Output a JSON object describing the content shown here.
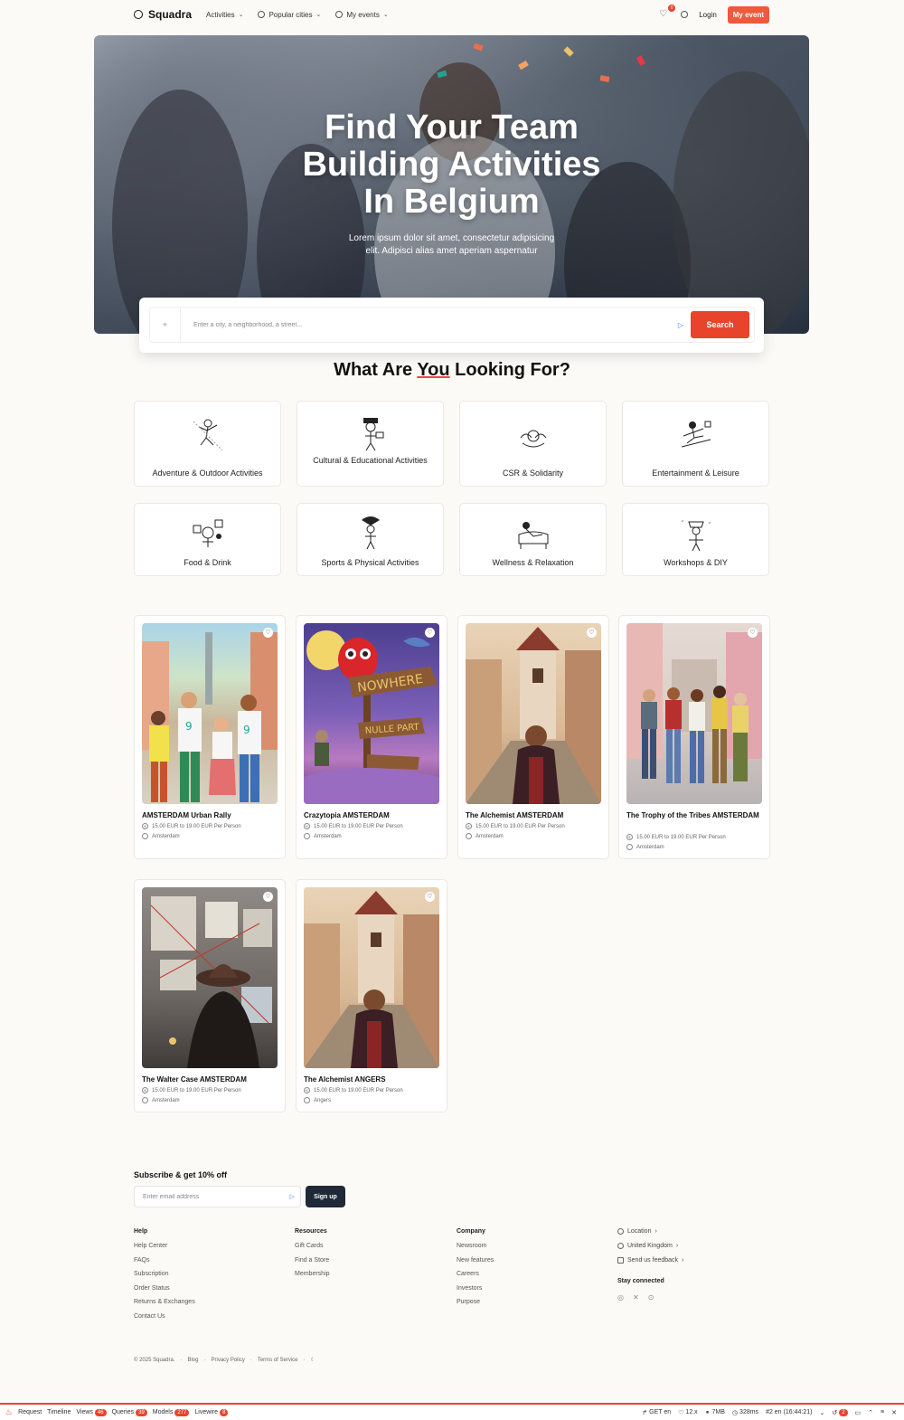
{
  "nav": {
    "brand": "Squadra",
    "menu": [
      {
        "label": "Activities"
      },
      {
        "label": "Popular cities"
      },
      {
        "label": "My events"
      }
    ],
    "favorites_count": "0",
    "login": "Login",
    "cta": "My event"
  },
  "hero": {
    "title_line1": "Find Your Team",
    "title_line2": "Building Activities",
    "title_line3": "In Belgium",
    "subtitle_line1": "Lorem ipsum dolor sit amet, consectetur adipisicing",
    "subtitle_line2": "elit. Adipisci alias amet aperiam aspernatur"
  },
  "search": {
    "placeholder": "Enter a city, a neighborhood, a street...",
    "button": "Search"
  },
  "categories_title": {
    "before": "What Are ",
    "highlight": "You",
    "after": " Looking For?"
  },
  "categories": [
    {
      "label": "Adventure & Outdoor Activities"
    },
    {
      "label": "Cultural & Educational Activities"
    },
    {
      "label": "CSR & Solidarity"
    },
    {
      "label": "Entertainment & Leisure"
    },
    {
      "label": "Food & Drink"
    },
    {
      "label": "Sports & Physical Activities"
    },
    {
      "label": "Wellness & Relaxation"
    },
    {
      "label": "Workshops & DIY"
    }
  ],
  "products": [
    {
      "title": "AMSTERDAM Urban Rally",
      "price": "15.00 EUR to 19.00 EUR Per Person",
      "city": "Amsterdam"
    },
    {
      "title": "Crazytopia AMSTERDAM",
      "price": "15.00 EUR to 19.00 EUR Per Person",
      "city": "Amsterdam"
    },
    {
      "title": "The Alchemist AMSTERDAM",
      "price": "15.00 EUR to 19.00 EUR Per Person",
      "city": "Amsterdam"
    },
    {
      "title": "The Trophy of the Tribes AMSTERDAM",
      "price": "15.00 EUR to 19.00 EUR Per Person",
      "city": "Amsterdam"
    },
    {
      "title": "The Walter Case AMSTERDAM",
      "price": "15.00 EUR to 19.00 EUR Per Person",
      "city": "Amsterdam"
    },
    {
      "title": "The Alchemist ANGERS",
      "price": "15.00 EUR to 19.00 EUR Per Person",
      "city": "Angers"
    }
  ],
  "footer": {
    "subscribe_title": "Subscribe & get 10% off",
    "email_placeholder": "Enter email address",
    "signup": "Sign up",
    "help": {
      "title": "Help",
      "links": [
        "Help Center",
        "FAQs",
        "Subscription",
        "Order Status",
        "Returns & Exchanges",
        "Contact Us"
      ]
    },
    "resources": {
      "title": "Resources",
      "links": [
        "Gift Cards",
        "Find a Store",
        "Membership"
      ]
    },
    "company": {
      "title": "Company",
      "links": [
        "Newsroom",
        "New features",
        "Careers",
        "Investors",
        "Purpose"
      ]
    },
    "settings": {
      "location": "Location",
      "country": "United Kingdom",
      "feedback": "Send us feedback"
    },
    "stay_connected": "Stay connected",
    "copyright": "© 2025 Squadra.",
    "blog": "Blog",
    "privacy": "Privacy Policy",
    "terms": "Terms of Service"
  },
  "debugbar": {
    "request": "Request",
    "timeline": "Timeline",
    "views": "Views",
    "views_count": "46",
    "queries": "Queries",
    "queries_count": "39",
    "models": "Models",
    "models_count": "277",
    "livewire": "Livewire",
    "livewire_count": "8",
    "method": "GET en",
    "php": "12.x",
    "memory": "7MB",
    "time": "328ms",
    "req_id": "#2 en (16:44:21)",
    "history_count": "2"
  }
}
